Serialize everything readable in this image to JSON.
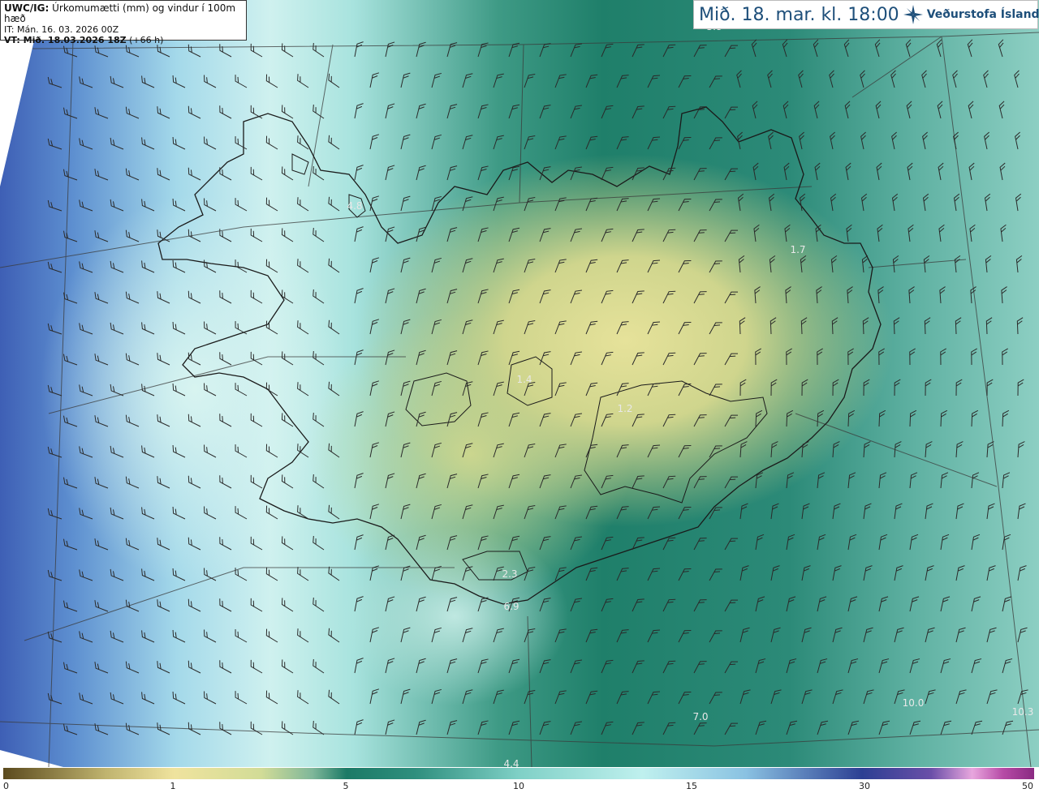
{
  "header": {
    "product": "UWC/IG:",
    "description": "Úrkomumætti (mm) og vindur í 100m hæð",
    "init_time": "IT: Mán. 16. 03. 2026 00Z",
    "valid_time_label": "VT: Mið. 18.03.2026 18Z",
    "lead": "(+66 h)"
  },
  "title": {
    "datetime": "Mið. 18. mar. kl. 18:00",
    "logo_text": "Veðurstofa Íslands",
    "logo_icon": "star-compass-icon"
  },
  "map_labels": [
    {
      "text": "5.8",
      "pos": [
        880,
        37
      ]
    },
    {
      "text": "4.8",
      "pos": [
        437,
        258
      ]
    },
    {
      "text": "1.7",
      "pos": [
        983,
        312
      ]
    },
    {
      "text": "1.4",
      "pos": [
        646,
        472
      ]
    },
    {
      "text": "1.2",
      "pos": [
        770,
        508
      ]
    },
    {
      "text": "2.3",
      "pos": [
        628,
        712
      ]
    },
    {
      "text": "6.9",
      "pos": [
        630,
        752
      ]
    },
    {
      "text": "10.0",
      "pos": [
        1125,
        871
      ]
    },
    {
      "text": "10.3",
      "pos": [
        1260,
        882
      ]
    },
    {
      "text": "7.0",
      "pos": [
        863,
        888
      ]
    },
    {
      "text": "4.4",
      "pos": [
        630,
        946
      ]
    }
  ],
  "colorbar": {
    "ticks": [
      "0",
      "1",
      "5",
      "10",
      "15",
      "30",
      "50"
    ],
    "colors": {
      "dry": "#5b4a1e",
      "low": "#efe39e",
      "mid": "#1c7a66",
      "high": "#bff0ee",
      "very_high": "#2c3f93",
      "extreme": "#8a2a82"
    }
  }
}
